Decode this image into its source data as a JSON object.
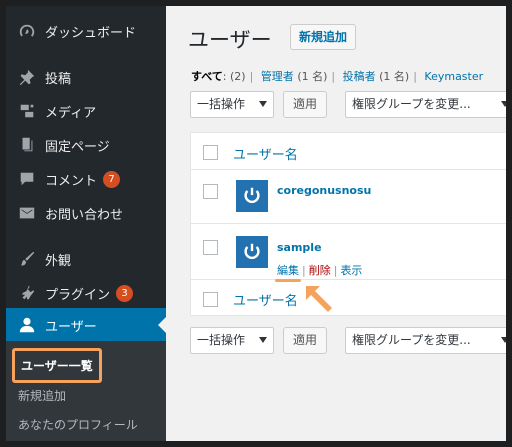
{
  "sidebar": {
    "items": [
      {
        "label": "ダッシュボード",
        "icon": "dashboard-icon"
      },
      {
        "label": "投稿",
        "icon": "pin-icon"
      },
      {
        "label": "メディア",
        "icon": "media-icon"
      },
      {
        "label": "固定ページ",
        "icon": "page-icon"
      },
      {
        "label": "コメント",
        "icon": "comment-icon",
        "badge": "7"
      },
      {
        "label": "お問い合わせ",
        "icon": "mail-icon"
      },
      {
        "label": "外観",
        "icon": "brush-icon"
      },
      {
        "label": "プラグイン",
        "icon": "plugin-icon",
        "badge": "3"
      },
      {
        "label": "ユーザー",
        "icon": "user-icon"
      }
    ],
    "submenu": [
      {
        "label": "ユーザー一覧"
      },
      {
        "label": "新規追加"
      },
      {
        "label": "あなたのプロフィール"
      }
    ]
  },
  "header": {
    "title": "ユーザー",
    "add_new": "新規追加"
  },
  "filters": {
    "all": "すべて",
    "all_count": "(2)",
    "admin": "管理者",
    "admin_count": "(1 名)",
    "contributor": "投稿者",
    "contributor_count": "(1 名)",
    "keymaster": "Keymaster"
  },
  "bulk": {
    "action": "一括操作",
    "apply": "適用",
    "role": "権限グループを変更..."
  },
  "table": {
    "column": "ユーザー名",
    "rows": [
      {
        "username": "coregonusnosu"
      },
      {
        "username": "sample",
        "actions": {
          "edit": "編集",
          "delete": "削除",
          "view": "表示"
        }
      }
    ]
  },
  "colors": {
    "sidebar": "#23282d",
    "active": "#0073aa",
    "highlight": "#f5a25d",
    "link": "#0073aa",
    "badge": "#d54e21"
  }
}
